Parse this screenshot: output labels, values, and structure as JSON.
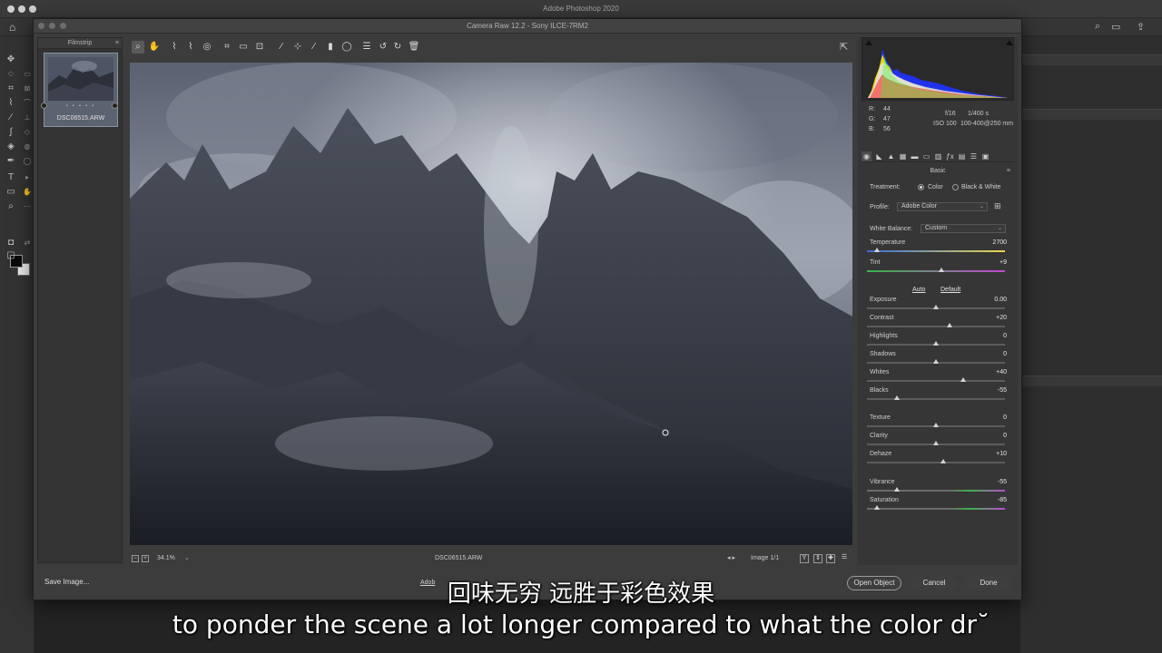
{
  "os": {
    "app_title": "Adobe Photoshop 2020"
  },
  "dialog": {
    "title": "Camera Raw 12.2  -  Sony ILCE-7RM2"
  },
  "filmstrip": {
    "header": "Filmstrip",
    "menu": "≡",
    "stars": "• • • • •",
    "file_name": "DSC06515.ARW"
  },
  "readout": {
    "r_label": "R:",
    "r_value": "44",
    "g_label": "G:",
    "g_value": "47",
    "b_label": "B:",
    "b_value": "56",
    "aperture": "f/16",
    "shutter": "1/400 s",
    "iso": "ISO 100",
    "lens": "100-400@250 mm"
  },
  "basic": {
    "header": "Basic",
    "menu": "≡",
    "treatment_label": "Treatment:",
    "treatment_color": "Color",
    "treatment_bw": "Black & White",
    "profile_label": "Profile:",
    "profile_value": "Adobe Color",
    "wb_label": "White Balance:",
    "wb_value": "Custom",
    "auto": "Auto",
    "default": "Default",
    "sliders": [
      {
        "label": "Temperature",
        "value": "2700",
        "pos": 0.07
      },
      {
        "label": "Tint",
        "value": "+9",
        "pos": 0.54
      },
      {
        "label": "Exposure",
        "value": "0.00",
        "pos": 0.5
      },
      {
        "label": "Contrast",
        "value": "+20",
        "pos": 0.6
      },
      {
        "label": "Highlights",
        "value": "0",
        "pos": 0.5
      },
      {
        "label": "Shadows",
        "value": "0",
        "pos": 0.5
      },
      {
        "label": "Whites",
        "value": "+40",
        "pos": 0.7
      },
      {
        "label": "Blacks",
        "value": "-55",
        "pos": 0.22
      },
      {
        "label": "Texture",
        "value": "0",
        "pos": 0.5
      },
      {
        "label": "Clarity",
        "value": "0",
        "pos": 0.5
      },
      {
        "label": "Dehaze",
        "value": "+10",
        "pos": 0.55
      },
      {
        "label": "Vibrance",
        "value": "-55",
        "pos": 0.22
      },
      {
        "label": "Saturation",
        "value": "-85",
        "pos": 0.07
      }
    ]
  },
  "preview_bar": {
    "zoom": "34.1%",
    "file_name": "DSC06515.ARW",
    "image_count": "Image 1/1"
  },
  "buttons": {
    "save_image": "Save Image...",
    "workflow": "Adob",
    "open_object": "Open Object",
    "cancel": "Cancel",
    "done": "Done"
  },
  "subtitles": {
    "cn": "回味无穷 远胜于彩色效果",
    "en": "to ponder the scene a lot longer compared to what the color dr˘"
  }
}
